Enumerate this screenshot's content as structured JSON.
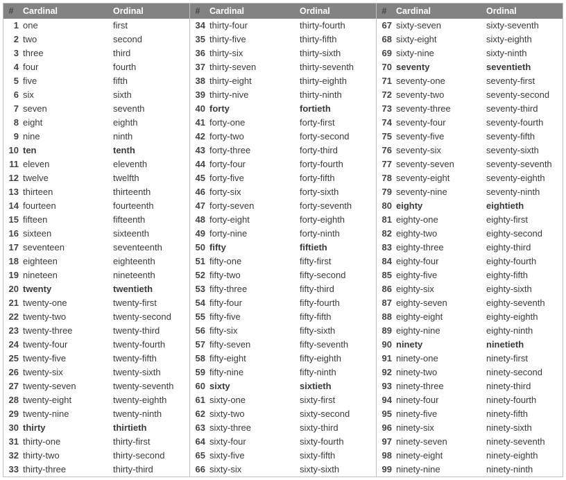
{
  "headers": {
    "num": "#",
    "cardinal": "Cardinal",
    "ordinal": "Ordinal"
  },
  "columns": [
    {
      "rows": [
        {
          "n": "1",
          "cardinal": "one",
          "ordinal": "first",
          "bold": false
        },
        {
          "n": "2",
          "cardinal": "two",
          "ordinal": "second",
          "bold": false
        },
        {
          "n": "3",
          "cardinal": "three",
          "ordinal": "third",
          "bold": false
        },
        {
          "n": "4",
          "cardinal": "four",
          "ordinal": "fourth",
          "bold": false
        },
        {
          "n": "5",
          "cardinal": "five",
          "ordinal": "fifth",
          "bold": false
        },
        {
          "n": "6",
          "cardinal": "six",
          "ordinal": "sixth",
          "bold": false
        },
        {
          "n": "7",
          "cardinal": "seven",
          "ordinal": "seventh",
          "bold": false
        },
        {
          "n": "8",
          "cardinal": "eight",
          "ordinal": "eighth",
          "bold": false
        },
        {
          "n": "9",
          "cardinal": "nine",
          "ordinal": "ninth",
          "bold": false
        },
        {
          "n": "10",
          "cardinal": "ten",
          "ordinal": "tenth",
          "bold": true
        },
        {
          "n": "11",
          "cardinal": "eleven",
          "ordinal": "eleventh",
          "bold": false
        },
        {
          "n": "12",
          "cardinal": "twelve",
          "ordinal": "twelfth",
          "bold": false
        },
        {
          "n": "13",
          "cardinal": "thirteen",
          "ordinal": "thirteenth",
          "bold": false
        },
        {
          "n": "14",
          "cardinal": "fourteen",
          "ordinal": "fourteenth",
          "bold": false
        },
        {
          "n": "15",
          "cardinal": "fifteen",
          "ordinal": "fifteenth",
          "bold": false
        },
        {
          "n": "16",
          "cardinal": "sixteen",
          "ordinal": "sixteenth",
          "bold": false
        },
        {
          "n": "17",
          "cardinal": "seventeen",
          "ordinal": "seventeenth",
          "bold": false
        },
        {
          "n": "18",
          "cardinal": "eighteen",
          "ordinal": "eighteenth",
          "bold": false
        },
        {
          "n": "19",
          "cardinal": "nineteen",
          "ordinal": "nineteenth",
          "bold": false
        },
        {
          "n": "20",
          "cardinal": "twenty",
          "ordinal": "twentieth",
          "bold": true
        },
        {
          "n": "21",
          "cardinal": "twenty-one",
          "ordinal": "twenty-first",
          "bold": false
        },
        {
          "n": "22",
          "cardinal": "twenty-two",
          "ordinal": "twenty-second",
          "bold": false
        },
        {
          "n": "23",
          "cardinal": "twenty-three",
          "ordinal": "twenty-third",
          "bold": false
        },
        {
          "n": "24",
          "cardinal": "twenty-four",
          "ordinal": "twenty-fourth",
          "bold": false
        },
        {
          "n": "25",
          "cardinal": "twenty-five",
          "ordinal": "twenty-fifth",
          "bold": false
        },
        {
          "n": "26",
          "cardinal": "twenty-six",
          "ordinal": "twenty-sixth",
          "bold": false
        },
        {
          "n": "27",
          "cardinal": "twenty-seven",
          "ordinal": "twenty-seventh",
          "bold": false
        },
        {
          "n": "28",
          "cardinal": "twenty-eight",
          "ordinal": "twenty-eighth",
          "bold": false
        },
        {
          "n": "29",
          "cardinal": "twenty-nine",
          "ordinal": "twenty-ninth",
          "bold": false
        },
        {
          "n": "30",
          "cardinal": "thirty",
          "ordinal": "thirtieth",
          "bold": true
        },
        {
          "n": "31",
          "cardinal": "thirty-one",
          "ordinal": "thirty-first",
          "bold": false
        },
        {
          "n": "32",
          "cardinal": "thirty-two",
          "ordinal": "thirty-second",
          "bold": false
        },
        {
          "n": "33",
          "cardinal": "thirty-three",
          "ordinal": "thirty-third",
          "bold": false
        }
      ]
    },
    {
      "rows": [
        {
          "n": "34",
          "cardinal": "thirty-four",
          "ordinal": "thirty-fourth",
          "bold": false
        },
        {
          "n": "35",
          "cardinal": "thirty-five",
          "ordinal": "thirty-fifth",
          "bold": false
        },
        {
          "n": "36",
          "cardinal": "thirty-six",
          "ordinal": "thirty-sixth",
          "bold": false
        },
        {
          "n": "37",
          "cardinal": "thirty-seven",
          "ordinal": "thirty-seventh",
          "bold": false
        },
        {
          "n": "38",
          "cardinal": "thirty-eight",
          "ordinal": "thirty-eighth",
          "bold": false
        },
        {
          "n": "39",
          "cardinal": "thirty-nive",
          "ordinal": "thirty-ninth",
          "bold": false
        },
        {
          "n": "40",
          "cardinal": "forty",
          "ordinal": "fortieth",
          "bold": true
        },
        {
          "n": "41",
          "cardinal": "forty-one",
          "ordinal": "forty-first",
          "bold": false
        },
        {
          "n": "42",
          "cardinal": "forty-two",
          "ordinal": "forty-second",
          "bold": false
        },
        {
          "n": "43",
          "cardinal": "forty-three",
          "ordinal": "forty-third",
          "bold": false
        },
        {
          "n": "44",
          "cardinal": "forty-four",
          "ordinal": "forty-fourth",
          "bold": false
        },
        {
          "n": "45",
          "cardinal": "forty-five",
          "ordinal": "forty-fifth",
          "bold": false
        },
        {
          "n": "46",
          "cardinal": "forty-six",
          "ordinal": "forty-sixth",
          "bold": false
        },
        {
          "n": "47",
          "cardinal": "forty-seven",
          "ordinal": "forty-seventh",
          "bold": false
        },
        {
          "n": "48",
          "cardinal": "forty-eight",
          "ordinal": "forty-eighth",
          "bold": false
        },
        {
          "n": "49",
          "cardinal": "forty-nine",
          "ordinal": "forty-ninth",
          "bold": false
        },
        {
          "n": "50",
          "cardinal": "fifty",
          "ordinal": "fiftieth",
          "bold": true
        },
        {
          "n": "51",
          "cardinal": "fifty-one",
          "ordinal": "fifty-first",
          "bold": false
        },
        {
          "n": "52",
          "cardinal": "fifty-two",
          "ordinal": "fifty-second",
          "bold": false
        },
        {
          "n": "53",
          "cardinal": "fifty-three",
          "ordinal": "fifty-third",
          "bold": false
        },
        {
          "n": "54",
          "cardinal": "fifty-four",
          "ordinal": "fifty-fourth",
          "bold": false
        },
        {
          "n": "55",
          "cardinal": "fifty-five",
          "ordinal": "fifty-fifth",
          "bold": false
        },
        {
          "n": "56",
          "cardinal": "fifty-six",
          "ordinal": "fifty-sixth",
          "bold": false
        },
        {
          "n": "57",
          "cardinal": "fifty-seven",
          "ordinal": "fifty-seventh",
          "bold": false
        },
        {
          "n": "58",
          "cardinal": "fifty-eight",
          "ordinal": "fifty-eighth",
          "bold": false
        },
        {
          "n": "59",
          "cardinal": "fifty-nine",
          "ordinal": "fifty-ninth",
          "bold": false
        },
        {
          "n": "60",
          "cardinal": "sixty",
          "ordinal": "sixtieth",
          "bold": true
        },
        {
          "n": "61",
          "cardinal": "sixty-one",
          "ordinal": "sixty-first",
          "bold": false
        },
        {
          "n": "62",
          "cardinal": "sixty-two",
          "ordinal": "sixty-second",
          "bold": false
        },
        {
          "n": "63",
          "cardinal": "sixty-three",
          "ordinal": "sixty-third",
          "bold": false
        },
        {
          "n": "64",
          "cardinal": "sixty-four",
          "ordinal": "sixty-fourth",
          "bold": false
        },
        {
          "n": "65",
          "cardinal": "sixty-five",
          "ordinal": "sixty-fifth",
          "bold": false
        },
        {
          "n": "66",
          "cardinal": "sixty-six",
          "ordinal": "sixty-sixth",
          "bold": false
        }
      ]
    },
    {
      "rows": [
        {
          "n": "67",
          "cardinal": "sixty-seven",
          "ordinal": "sixty-seventh",
          "bold": false
        },
        {
          "n": "68",
          "cardinal": "sixty-eight",
          "ordinal": "sixty-eighth",
          "bold": false
        },
        {
          "n": "69",
          "cardinal": "sixty-nine",
          "ordinal": "sixty-ninth",
          "bold": false
        },
        {
          "n": "70",
          "cardinal": "seventy",
          "ordinal": "seventieth",
          "bold": true
        },
        {
          "n": "71",
          "cardinal": "seventy-one",
          "ordinal": "seventy-first",
          "bold": false
        },
        {
          "n": "72",
          "cardinal": "seventy-two",
          "ordinal": "seventy-second",
          "bold": false
        },
        {
          "n": "73",
          "cardinal": "seventy-three",
          "ordinal": "seventy-third",
          "bold": false
        },
        {
          "n": "74",
          "cardinal": "seventy-four",
          "ordinal": "seventy-fourth",
          "bold": false
        },
        {
          "n": "75",
          "cardinal": "seventy-five",
          "ordinal": "seventy-fifth",
          "bold": false
        },
        {
          "n": "76",
          "cardinal": "seventy-six",
          "ordinal": "seventy-sixth",
          "bold": false
        },
        {
          "n": "77",
          "cardinal": "seventy-seven",
          "ordinal": "seventy-seventh",
          "bold": false
        },
        {
          "n": "78",
          "cardinal": "seventy-eight",
          "ordinal": "seventy-eighth",
          "bold": false
        },
        {
          "n": "79",
          "cardinal": "seventy-nine",
          "ordinal": "seventy-ninth",
          "bold": false
        },
        {
          "n": "80",
          "cardinal": "eighty",
          "ordinal": "eightieth",
          "bold": true
        },
        {
          "n": "81",
          "cardinal": "eighty-one",
          "ordinal": "eighty-first",
          "bold": false
        },
        {
          "n": "82",
          "cardinal": "eighty-two",
          "ordinal": "eighty-second",
          "bold": false
        },
        {
          "n": "83",
          "cardinal": "eighty-three",
          "ordinal": "eighty-third",
          "bold": false
        },
        {
          "n": "84",
          "cardinal": "eighty-four",
          "ordinal": "eighty-fourth",
          "bold": false
        },
        {
          "n": "85",
          "cardinal": "eighty-five",
          "ordinal": "eighty-fifth",
          "bold": false
        },
        {
          "n": "86",
          "cardinal": "eighty-six",
          "ordinal": "eighty-sixth",
          "bold": false
        },
        {
          "n": "87",
          "cardinal": "eighty-seven",
          "ordinal": "eighty-seventh",
          "bold": false
        },
        {
          "n": "88",
          "cardinal": "eighty-eight",
          "ordinal": "eighty-eighth",
          "bold": false
        },
        {
          "n": "89",
          "cardinal": "eighty-nine",
          "ordinal": "eighty-ninth",
          "bold": false
        },
        {
          "n": "90",
          "cardinal": "ninety",
          "ordinal": "ninetieth",
          "bold": true
        },
        {
          "n": "91",
          "cardinal": "ninety-one",
          "ordinal": "ninety-first",
          "bold": false
        },
        {
          "n": "92",
          "cardinal": "ninety-two",
          "ordinal": "ninety-second",
          "bold": false
        },
        {
          "n": "93",
          "cardinal": "ninety-three",
          "ordinal": "ninety-third",
          "bold": false
        },
        {
          "n": "94",
          "cardinal": "ninety-four",
          "ordinal": "ninety-fourth",
          "bold": false
        },
        {
          "n": "95",
          "cardinal": "ninety-five",
          "ordinal": "ninety-fifth",
          "bold": false
        },
        {
          "n": "96",
          "cardinal": "ninety-six",
          "ordinal": "ninety-sixth",
          "bold": false
        },
        {
          "n": "97",
          "cardinal": "ninety-seven",
          "ordinal": "ninety-seventh",
          "bold": false
        },
        {
          "n": "98",
          "cardinal": "ninety-eight",
          "ordinal": "ninety-eighth",
          "bold": false
        },
        {
          "n": "99",
          "cardinal": "ninety-nine",
          "ordinal": "ninety-ninth",
          "bold": false
        }
      ]
    }
  ]
}
